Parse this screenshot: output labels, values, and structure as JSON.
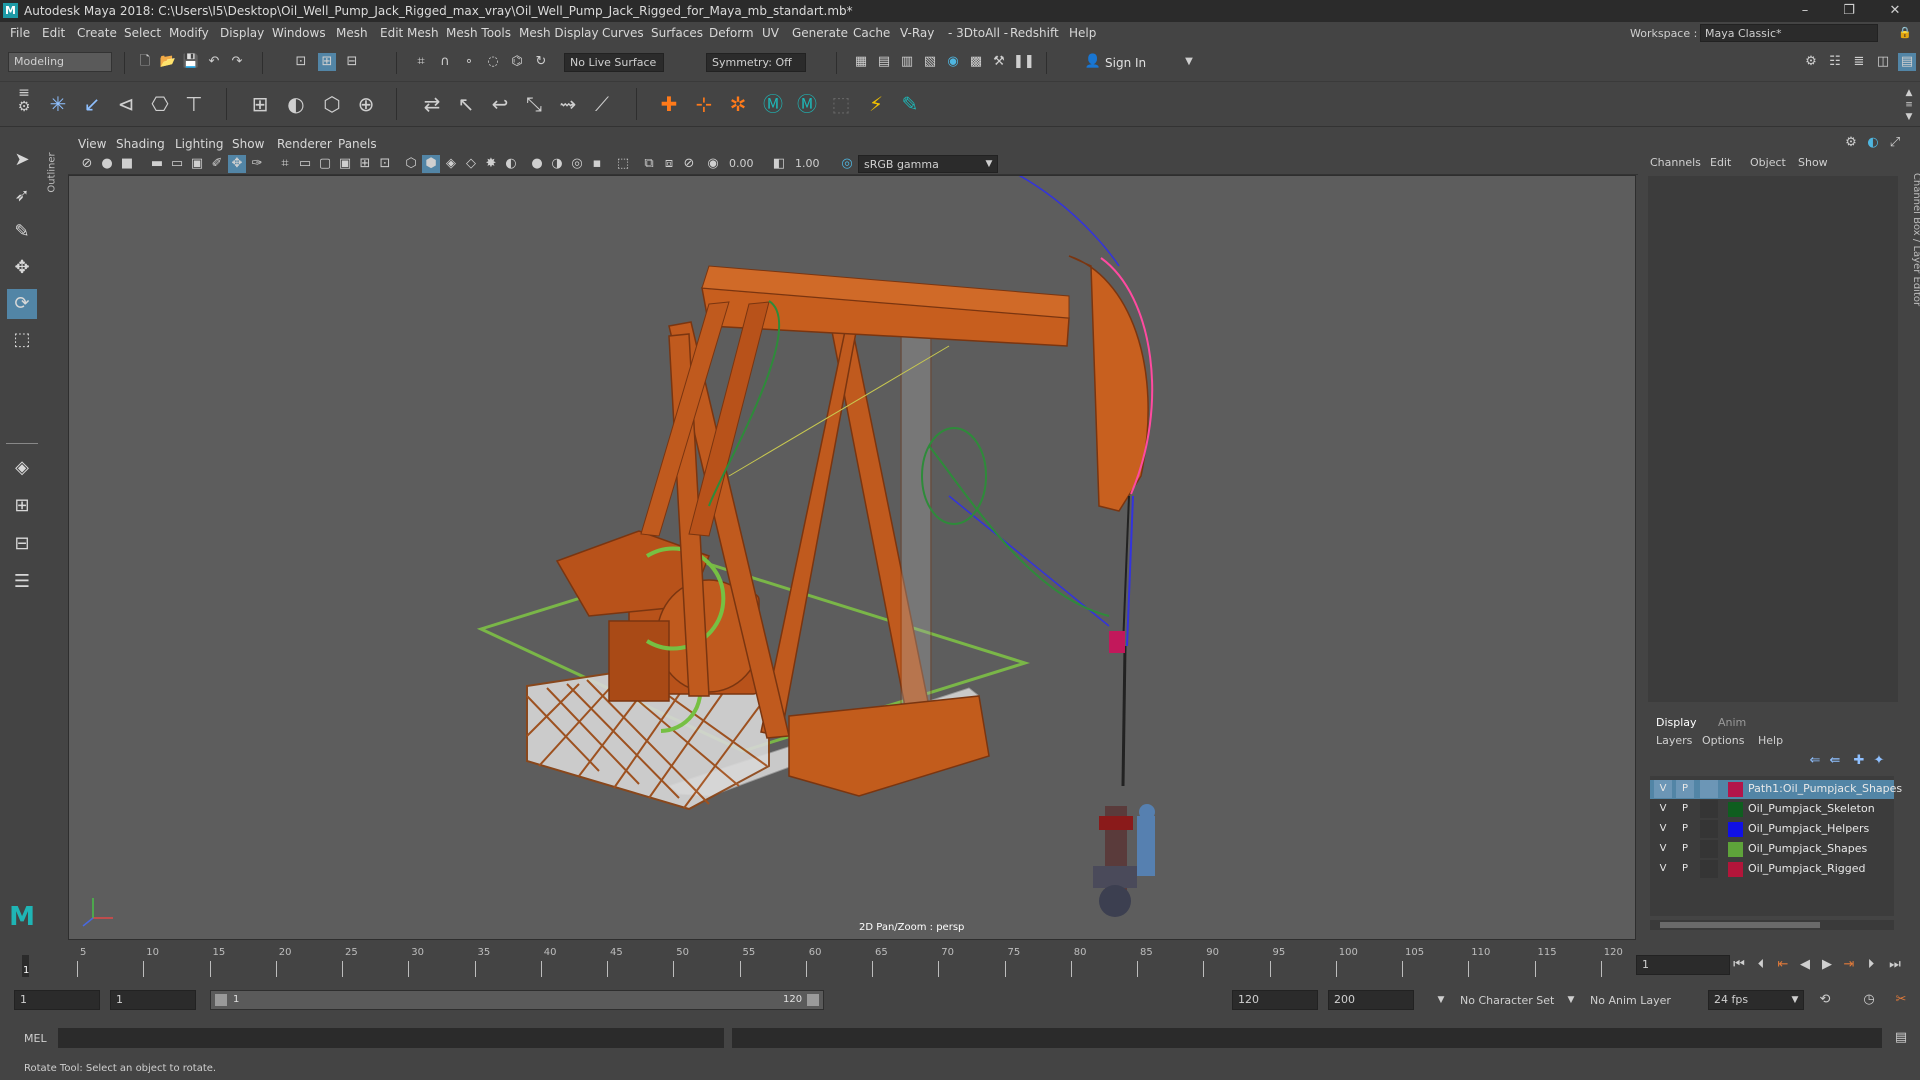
{
  "titlebar": {
    "title": "Autodesk Maya 2018: C:\\Users\\I5\\Desktop\\Oil_Well_Pump_Jack_Rigged_max_vray\\Oil_Well_Pump_Jack_Rigged_for_Maya_mb_standart.mb*",
    "minimize": "–",
    "maximize": "❐",
    "close": "✕"
  },
  "menubar": {
    "items": [
      "File",
      "Edit",
      "Create",
      "Select",
      "Modify",
      "Display",
      "Windows",
      "Mesh",
      "Edit Mesh",
      "Mesh Tools",
      "Mesh Display",
      "Curves",
      "Surfaces",
      "Deform",
      "UV",
      "Generate",
      "Cache",
      "V-Ray",
      "- 3DtoAll -",
      "Redshift",
      "Help"
    ],
    "workspace_label": "Workspace :",
    "workspace_value": "Maya Classic*"
  },
  "statusline": {
    "mode": "Modeling",
    "live_surface": "No Live Surface",
    "symmetry": "Symmetry: Off",
    "sign_in": "Sign In"
  },
  "panel": {
    "menus": [
      "View",
      "Shading",
      "Lighting",
      "Show",
      "Renderer",
      "Panels"
    ],
    "exposure": "0.00",
    "gamma": "1.00",
    "colorspace": "sRGB gamma",
    "camera_label": "2D Pan/Zoom : persp"
  },
  "outliner_tab": "Outliner",
  "channelbox": {
    "menus": [
      "Channels",
      "Edit",
      "Object",
      "Show"
    ],
    "vertical_label": "Channel Box / Layer Editor"
  },
  "layereditor": {
    "tabs": [
      "Display",
      "Anim"
    ],
    "menus": [
      "Layers",
      "Options",
      "Help"
    ],
    "layers": [
      {
        "v": "V",
        "p": "P",
        "color": "#b3154a",
        "name": "Path1:Oil_Pumpjack_Shapes"
      },
      {
        "v": "V",
        "p": "P",
        "color": "#0f5e1f",
        "name": "Oil_Pumpjack_Skeleton"
      },
      {
        "v": "V",
        "p": "P",
        "color": "#1010e6",
        "name": "Oil_Pumpjack_Helpers"
      },
      {
        "v": "V",
        "p": "P",
        "color": "#5ea33a",
        "name": "Oil_Pumpjack_Shapes"
      },
      {
        "v": "V",
        "p": "P",
        "color": "#b3153a",
        "name": "Oil_Pumpjack_Rigged"
      }
    ]
  },
  "timeslider": {
    "tick_labels": [
      "5",
      "10",
      "15",
      "20",
      "25",
      "30",
      "35",
      "40",
      "45",
      "50",
      "55",
      "60",
      "65",
      "70",
      "75",
      "80",
      "85",
      "90",
      "95",
      "100",
      "105",
      "110",
      "115",
      "120"
    ],
    "current_frame_marker": "1",
    "current_frame_field": "1"
  },
  "rangeslider": {
    "start": "1",
    "playback_start": "1",
    "range_left_label": "1",
    "range_right_label": "120",
    "playback_end": "120",
    "end": "200",
    "character_set": "No Character Set",
    "anim_layer": "No Anim Layer",
    "fps": "24 fps"
  },
  "cmdline": {
    "language": "MEL"
  },
  "helpline": {
    "text": "Rotate Tool: Select an object to rotate."
  },
  "colors": {
    "ui_bg": "#444444",
    "viewport_bg": "#5d5d5d",
    "selection_blue": "#5285a6",
    "pumpjack_orange": "#c0561a"
  }
}
